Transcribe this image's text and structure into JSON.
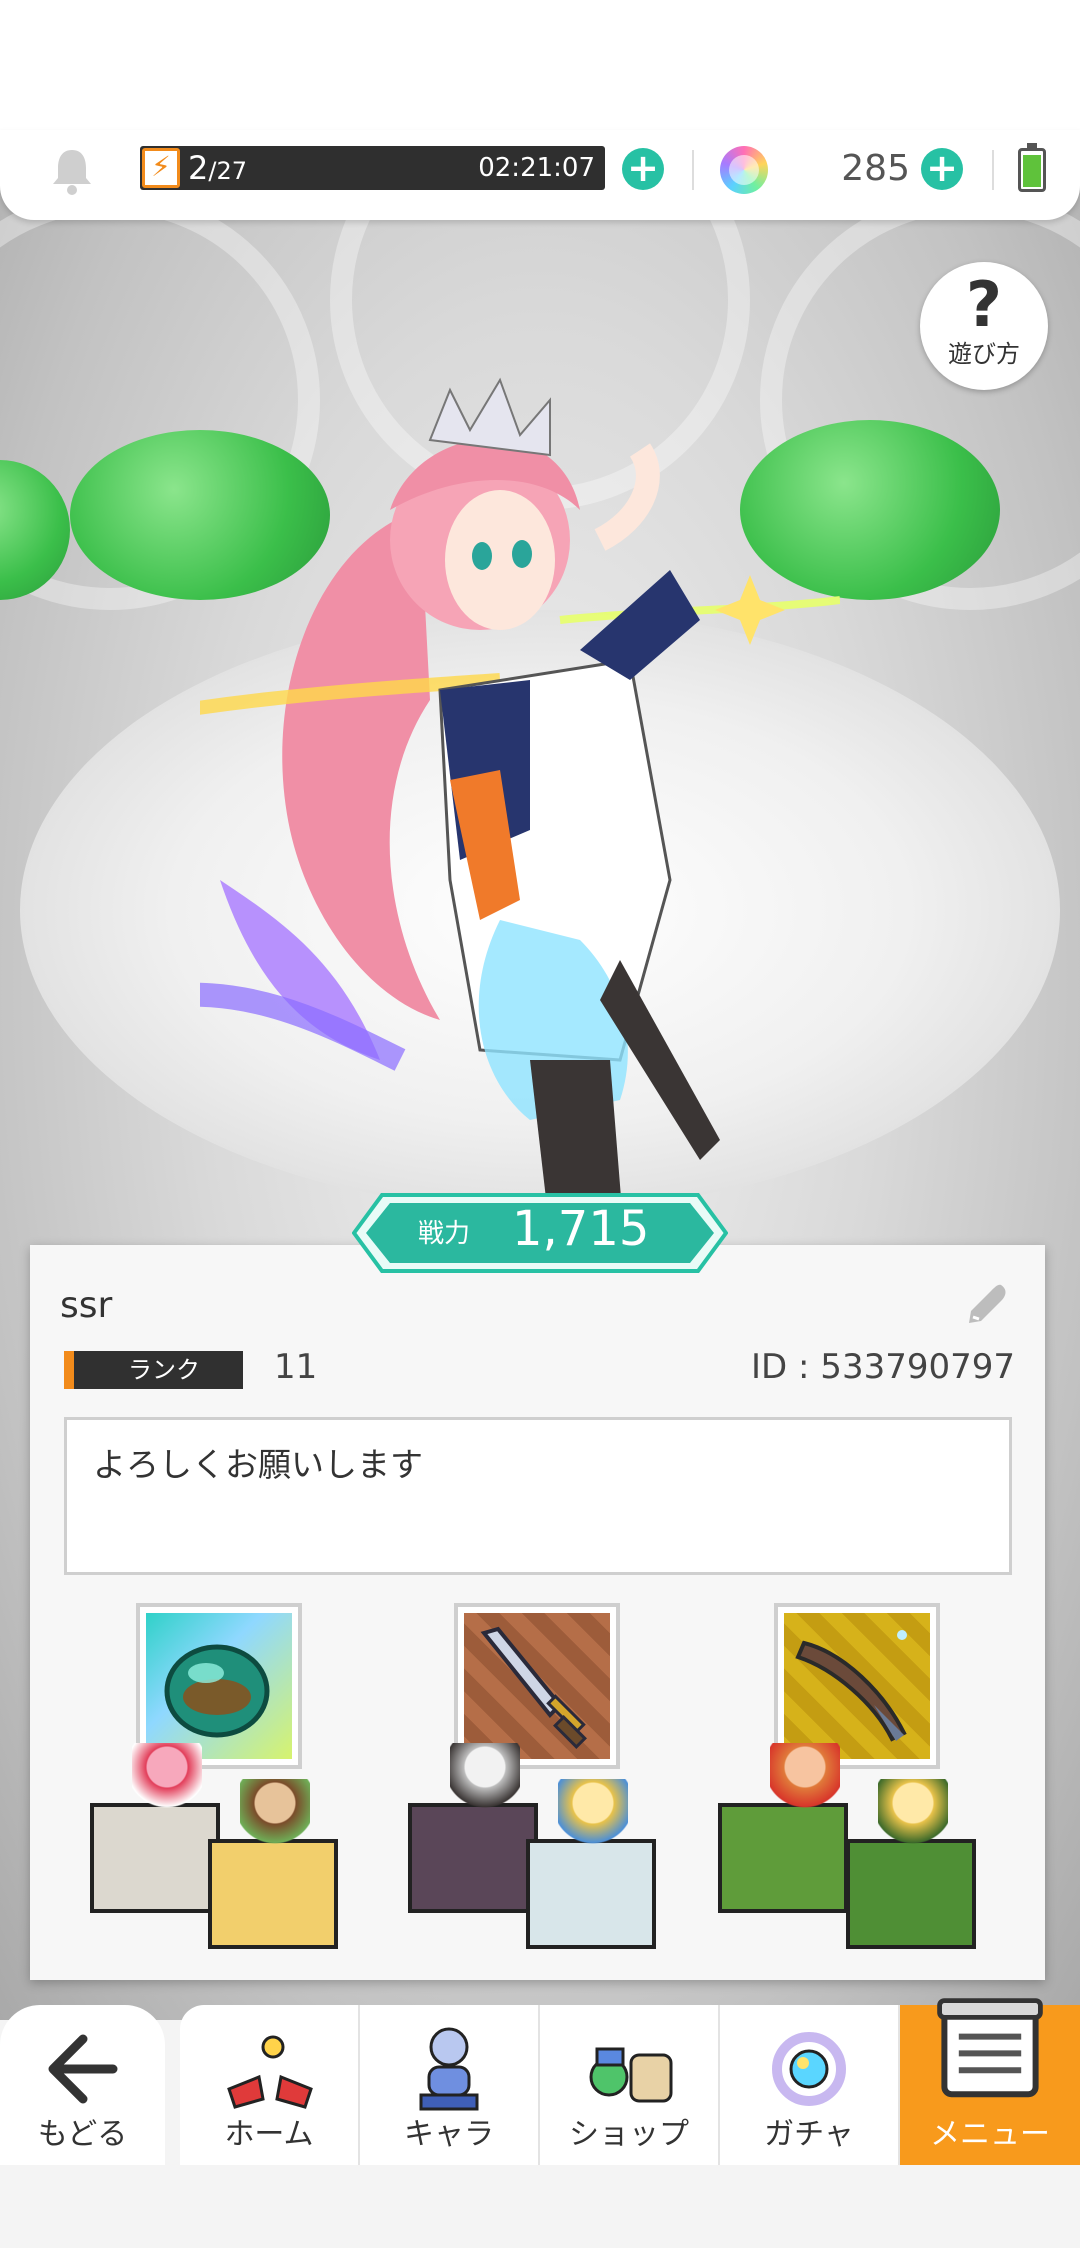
{
  "header": {
    "stamina": {
      "current": "2",
      "max": "/27",
      "timer": "02:21:07"
    },
    "gem_count": "285"
  },
  "help": {
    "icon": "?",
    "label": "遊び方"
  },
  "power": {
    "label": "戦力",
    "value": "1,715"
  },
  "profile": {
    "name": "ssr",
    "rank_label": "ランク",
    "rank_value": "11",
    "id_text": "ID : 533790797",
    "comment": "よろしくお願いします"
  },
  "teams": [
    {
      "equipment_icon": "orb-icon",
      "equipment_bg": "blue"
    },
    {
      "equipment_icon": "sword-icon",
      "equipment_bg": "brown"
    },
    {
      "equipment_icon": "quill-dagger-icon",
      "equipment_bg": "gold"
    }
  ],
  "nav": {
    "back": "もどる",
    "home": "ホーム",
    "chara": "キャラ",
    "shop": "ショップ",
    "gacha": "ガチャ",
    "menu": "メニュー"
  },
  "colors": {
    "accent_teal": "#27c1a4",
    "accent_orange": "#f89a1c",
    "stamina_bar": "#2f2f2f"
  }
}
